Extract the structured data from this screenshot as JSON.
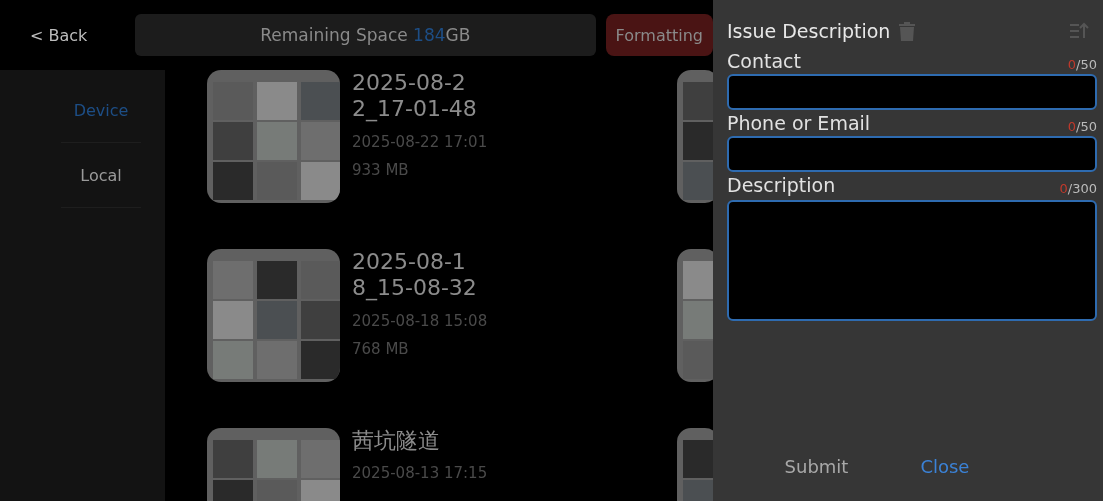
{
  "top_bar": {
    "back": "< Back",
    "storage_label": "Remaining Space ",
    "storage_value": "184",
    "storage_unit": "GB",
    "format_button": "Formatting"
  },
  "sidebar": {
    "items": [
      {
        "label": "Device",
        "selected": true
      },
      {
        "label": "Local",
        "selected": false
      }
    ]
  },
  "files": [
    {
      "name": "2025-08-2\n2_17-01-48",
      "date": "2025-08-22 17:01",
      "size": "933 MB"
    },
    {
      "name": "2025-08-1\n8_15-08-32",
      "date": "2025-08-18 15:08",
      "size": "768 MB"
    },
    {
      "name": "茜坑隧道",
      "date": "2025-08-13 17:15"
    }
  ],
  "dialog": {
    "title": "Issue Description",
    "fields": [
      {
        "kind": "line",
        "label": "Contact",
        "count": "0",
        "limit": "/50"
      },
      {
        "kind": "line",
        "label": "Phone or Email",
        "count": "0",
        "limit": "/50"
      },
      {
        "kind": "area",
        "label": "Description",
        "count": "0",
        "limit": "/300"
      }
    ],
    "submit": "Submit",
    "close": "Close"
  }
}
